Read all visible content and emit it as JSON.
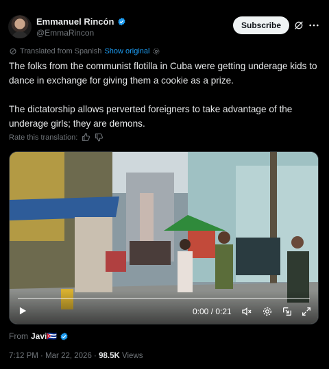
{
  "author": {
    "name": "Emmanuel Rincón",
    "handle": "@EmmaRincon",
    "verified_color": "#1d9bf0"
  },
  "actions": {
    "subscribe_label": "Subscribe",
    "icons": [
      "grok-icon",
      "more-icon"
    ]
  },
  "translation": {
    "label": "Translated from Spanish",
    "show_original": "Show original",
    "rate_label": "Rate this translation:"
  },
  "tweet": {
    "paragraph1": "The folks from the communist flotilla in Cuba were getting underage kids to dance in exchange for giving them a cookie as a prize.",
    "paragraph2": "The dictatorship allows perverted foreigners to take advantage of the underage girls; they are demons."
  },
  "video": {
    "time": "0:00 / 0:21",
    "progress": 0,
    "controls": [
      "play-icon",
      "mute-icon",
      "settings-icon",
      "pip-icon",
      "fullscreen-icon"
    ]
  },
  "source": {
    "from_label": "From",
    "author": "Javi🇨🇺"
  },
  "meta": {
    "time": "7:12 PM",
    "separator": "·",
    "date": "Mar 22, 2026",
    "views_count": "98.5K",
    "views_label": "Views"
  },
  "colors": {
    "background": "#000000",
    "text": "#e7e9ea",
    "muted": "#71767b",
    "link": "#1d9bf0"
  }
}
